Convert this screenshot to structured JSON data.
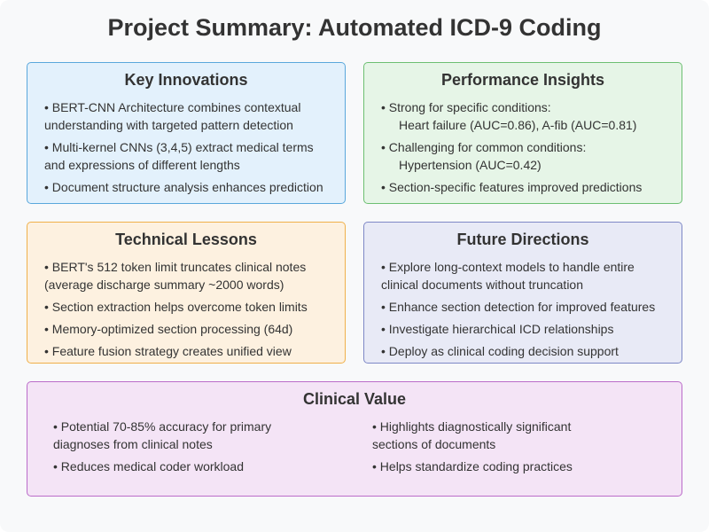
{
  "title": "Project Summary: Automated ICD-9 Coding",
  "colors": {
    "page_background": "#f8f9fa",
    "innovations_bg": "#e3f1fc",
    "innovations_border": "#5aa8dc",
    "performance_bg": "#e6f5e7",
    "performance_border": "#6dbf72",
    "lessons_bg": "#fdf1e0",
    "lessons_border": "#f0b04a",
    "future_bg": "#e8eaf6",
    "future_border": "#7e88c6",
    "clinical_bg": "#f4e4f6",
    "clinical_border": "#bb6cc9"
  },
  "innovations": {
    "heading": "Key Innovations",
    "items": [
      {
        "line1": "• BERT-CNN Architecture combines contextual",
        "line2": "understanding with targeted pattern detection"
      },
      {
        "line1": "• Multi-kernel CNNs (3,4,5) extract medical terms",
        "line2": "and expressions of different lengths"
      },
      {
        "line1": "• Document structure analysis enhances prediction"
      }
    ]
  },
  "performance": {
    "heading": "Performance Insights",
    "items": [
      {
        "line1": "• Strong for specific conditions:",
        "line2": "Heart failure (AUC=0.86), A-fib (AUC=0.81)"
      },
      {
        "line1": "• Challenging for common conditions:",
        "line2": "Hypertension (AUC=0.42)"
      },
      {
        "line1": "• Section-specific features improved predictions"
      }
    ]
  },
  "lessons": {
    "heading": "Technical Lessons",
    "items": [
      {
        "line1": "• BERT's 512 token limit truncates clinical notes",
        "line2": "(average discharge summary ~2000 words)"
      },
      {
        "line1": "• Section extraction helps overcome token limits"
      },
      {
        "line1": "• Memory-optimized section processing (64d)"
      },
      {
        "line1": "• Feature fusion strategy creates unified view"
      }
    ]
  },
  "future": {
    "heading": "Future Directions",
    "items": [
      {
        "line1": "• Explore long-context models to handle entire",
        "line2": "clinical documents without truncation"
      },
      {
        "line1": "• Enhance section detection for improved features"
      },
      {
        "line1": "• Investigate hierarchical ICD relationships"
      },
      {
        "line1": "• Deploy as clinical coding decision support"
      }
    ]
  },
  "clinical": {
    "heading": "Clinical Value",
    "left_items": [
      {
        "line1": "• Potential 70-85% accuracy for primary",
        "line2": "diagnoses from clinical notes"
      },
      {
        "line1": "• Reduces medical coder workload"
      }
    ],
    "right_items": [
      {
        "line1": "• Highlights diagnostically significant",
        "line2": "sections of documents"
      },
      {
        "line1": "• Helps standardize coding practices"
      }
    ]
  }
}
